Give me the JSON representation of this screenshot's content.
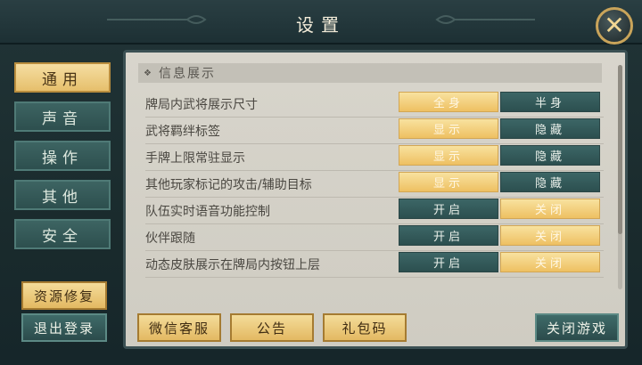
{
  "title": "设置",
  "sidebar": {
    "tabs": [
      {
        "label": "通用",
        "active": true
      },
      {
        "label": "声音",
        "active": false
      },
      {
        "label": "操作",
        "active": false
      },
      {
        "label": "其他",
        "active": false
      },
      {
        "label": "安全",
        "active": false
      }
    ],
    "repair_button": "资源修复",
    "logout_button": "退出登录"
  },
  "panel": {
    "section_title": "信息展示",
    "rows": [
      {
        "label": "牌局内武将展示尺寸",
        "left": "全身",
        "right": "半身",
        "selected": "left"
      },
      {
        "label": "武将羁绊标签",
        "left": "显示",
        "right": "隐藏",
        "selected": "left"
      },
      {
        "label": "手牌上限常驻显示",
        "left": "显示",
        "right": "隐藏",
        "selected": "left"
      },
      {
        "label": "其他玩家标记的攻击/辅助目标",
        "left": "显示",
        "right": "隐藏",
        "selected": "left"
      },
      {
        "label": "队伍实时语音功能控制",
        "left": "开启",
        "right": "关闭",
        "selected": "right"
      },
      {
        "label": "伙伴跟随",
        "left": "开启",
        "right": "关闭",
        "selected": "right"
      },
      {
        "label": "动态皮肤展示在牌局内按钮上层",
        "left": "开启",
        "right": "关闭",
        "selected": "right"
      }
    ]
  },
  "footer": {
    "wechat_service": "微信客服",
    "announcement": "公告",
    "gift_code": "礼包码",
    "quit_game": "关闭游戏"
  },
  "icons": {
    "close": "close-icon"
  },
  "colors": {
    "gold": "#eec062",
    "teal": "#2c4f4f",
    "panel": "#d8d5cc"
  }
}
